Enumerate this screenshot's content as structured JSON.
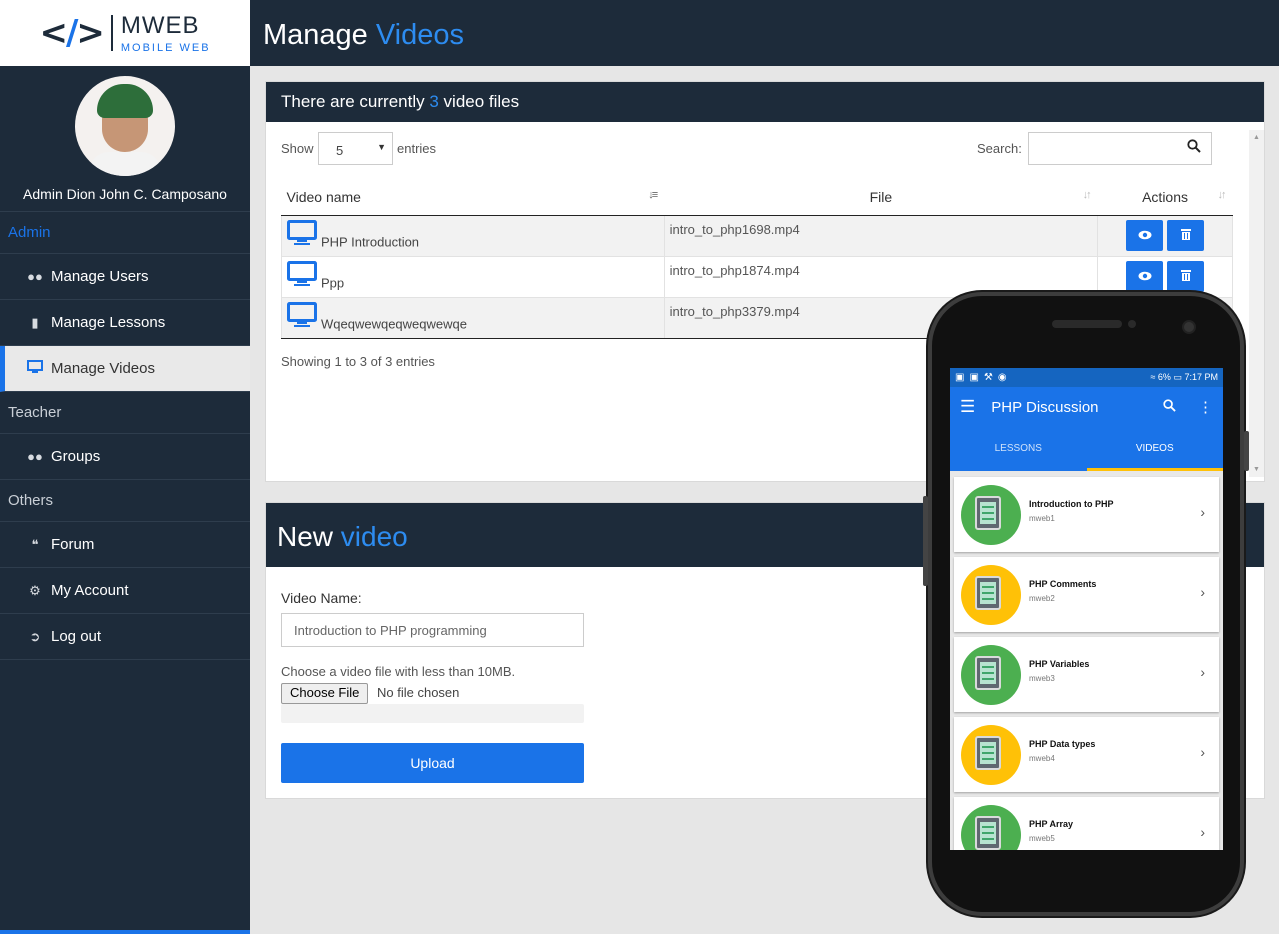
{
  "brand": {
    "name": "MWEB",
    "tagline": "MOBILE WEB"
  },
  "profile": {
    "name": "Admin Dion John C. Camposano"
  },
  "sidebar": {
    "sections": [
      {
        "label": "Admin",
        "items": [
          {
            "label": "Manage Users",
            "icon": "users-icon"
          },
          {
            "label": "Manage Lessons",
            "icon": "book-icon"
          },
          {
            "label": "Manage Videos",
            "icon": "monitor-icon"
          }
        ]
      },
      {
        "label": "Teacher",
        "items": [
          {
            "label": "Groups",
            "icon": "users-icon"
          }
        ]
      },
      {
        "label": "Others",
        "items": [
          {
            "label": "Forum",
            "icon": "comments-icon"
          },
          {
            "label": "My Account",
            "icon": "cogs-icon"
          },
          {
            "label": "Log out",
            "icon": "sign-out-icon"
          }
        ]
      }
    ]
  },
  "header": {
    "title_prefix": "Manage ",
    "title_accent": "Videos"
  },
  "videos_panel": {
    "heading_prefix": "There are currently ",
    "count": "3",
    "heading_suffix": " video files",
    "show_label": "Show",
    "entries_value": "5",
    "entries_label": "entries",
    "search_label": "Search:",
    "columns": [
      "Video name",
      "File",
      "Actions"
    ],
    "rows": [
      {
        "name": "PHP Introduction",
        "file": "intro_to_php1698.mp4"
      },
      {
        "name": "Ppp",
        "file": "intro_to_php1874.mp4"
      },
      {
        "name": "Wqeqwewqeqweqwewqe",
        "file": "intro_to_php3379.mp4"
      }
    ],
    "showing": "Showing 1 to 3 of 3 entries"
  },
  "new_video": {
    "heading_prefix": "New ",
    "heading_accent": "video",
    "name_label": "Video Name:",
    "name_value": "Introduction to PHP programming",
    "file_label": "Choose a video file with less than 10MB.",
    "choose_button": "Choose File",
    "no_file": "No file chosen",
    "upload_button": "Upload"
  },
  "phone": {
    "status_battery": "6%",
    "status_time": "7:17 PM",
    "app_title": "PHP Discussion",
    "tabs": [
      "LESSONS",
      "VIDEOS"
    ],
    "active_tab": "VIDEOS",
    "items": [
      {
        "title": "Introduction to PHP",
        "sub": "mweb1",
        "color": "#4caf50"
      },
      {
        "title": "PHP Comments",
        "sub": "mweb2",
        "color": "#ffc107"
      },
      {
        "title": "PHP Variables",
        "sub": "mweb3",
        "color": "#4caf50"
      },
      {
        "title": "PHP Data types",
        "sub": "mweb4",
        "color": "#ffc107"
      },
      {
        "title": "PHP Array",
        "sub": "mweb5",
        "color": "#4caf50"
      }
    ]
  },
  "colors": {
    "accent": "#1a73e8",
    "navy": "#1d2b3a",
    "title_accent": "#2d8cf0"
  }
}
